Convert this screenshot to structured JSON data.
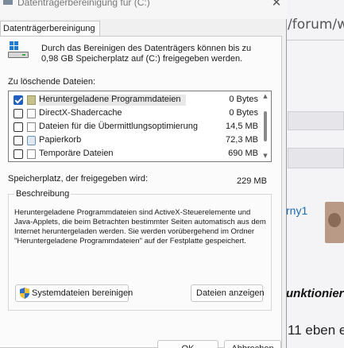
{
  "window": {
    "title": "Datenträgerbereinigung für (C:)",
    "close_glyph": "✕"
  },
  "tab": {
    "label": "Datenträgerbereinigung"
  },
  "intro": {
    "text": "Durch das Bereinigen des Datenträgers können bis zu 0,98 GB Speicherplatz auf  (C:) freigegeben werden."
  },
  "list": {
    "label": "Zu löschende Dateien:",
    "items": [
      {
        "name": "Heruntergeladene Programmdateien",
        "size": "0 Bytes",
        "checked": true,
        "icon": "folder-icon"
      },
      {
        "name": "DirectX-Shadercache",
        "size": "0 Bytes",
        "checked": false,
        "icon": "file-icon"
      },
      {
        "name": "Dateien für die Übermittlungsoptimierung",
        "size": "14,5 MB",
        "checked": false,
        "icon": "file-icon"
      },
      {
        "name": "Papierkorb",
        "size": "72,3 MB",
        "checked": false,
        "icon": "recycle-bin-icon"
      },
      {
        "name": "Temporäre Dateien",
        "size": "690 MB",
        "checked": false,
        "icon": "file-icon"
      }
    ]
  },
  "space": {
    "label": "Speicherplatz, der freigegeben wird:",
    "value": "229 MB"
  },
  "description": {
    "title": "Beschreibung",
    "text": "Heruntergeladene Programmdateien sind ActiveX-Steuerelemente und Java-Applets, die beim Betrachten bestimmter Seiten automatisch aus dem Internet heruntergeladen werden. Sie werden vorübergehend im Ordner \"Heruntergeladene Programmdateien\" auf der Festplatte gespeichert."
  },
  "buttons": {
    "system_cleanup": "Systemdateien bereinigen",
    "view_files": "Dateien anzeigen",
    "ok": "OK",
    "cancel": "Abbrechen"
  },
  "background": {
    "url_fragment": "/forum/wi",
    "username_fragment": "rny1",
    "heading_fragment": "unktionier",
    "text_fragment": "11 eben e"
  },
  "colors": {
    "accent": "#1f5fbf",
    "windows_blue": "#1f7ad6",
    "link": "#1e6bb0"
  }
}
